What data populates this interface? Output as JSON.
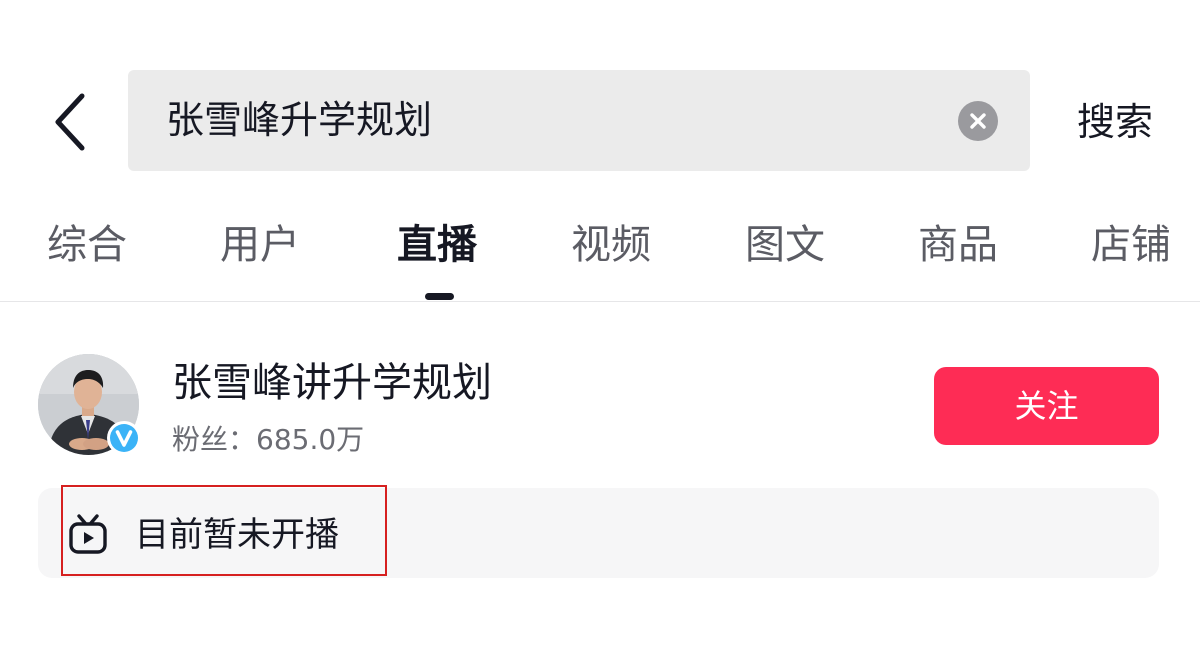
{
  "header": {
    "back_icon": "chevron-left-icon",
    "search": {
      "value": "张雪峰升学规划",
      "clear_icon": "clear-circle-icon"
    },
    "search_button_label": "搜索"
  },
  "tabs": [
    {
      "label": "综合",
      "active": false
    },
    {
      "label": "用户",
      "active": false
    },
    {
      "label": "直播",
      "active": true
    },
    {
      "label": "视频",
      "active": false
    },
    {
      "label": "图文",
      "active": false
    },
    {
      "label": "商品",
      "active": false
    },
    {
      "label": "店铺",
      "active": false
    }
  ],
  "result": {
    "user_name": "张雪峰讲升学规划",
    "fans_text": "粉丝：685.0万",
    "verified_icon": "verified-v-badge-icon",
    "follow_label": "关注",
    "live_status": {
      "icon": "tv-live-icon",
      "text": "目前暂未开播"
    }
  },
  "colors": {
    "accent": "#fe2c55",
    "text_primary": "#161823",
    "text_secondary": "#6b6c73",
    "search_bg": "#ebebeb",
    "panel_bg": "#f6f6f7",
    "highlight_border": "#d62020"
  }
}
